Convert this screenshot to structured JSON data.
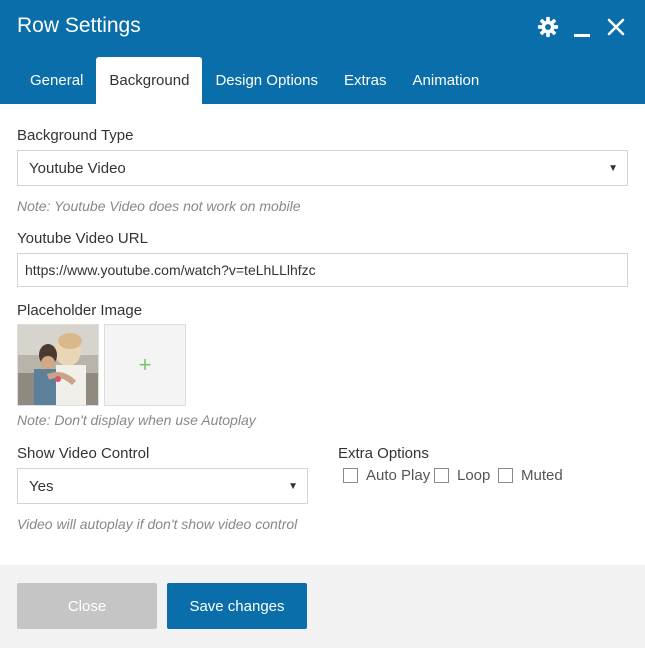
{
  "window": {
    "title": "Row Settings"
  },
  "header_icons": [
    "gear-icon",
    "minimize-icon",
    "close-icon"
  ],
  "tabs": [
    {
      "label": "General",
      "active": false
    },
    {
      "label": "Background",
      "active": true
    },
    {
      "label": "Design Options",
      "active": false
    },
    {
      "label": "Extras",
      "active": false
    },
    {
      "label": "Animation",
      "active": false
    }
  ],
  "background_type": {
    "label": "Background Type",
    "value": "Youtube Video",
    "note": "Note: Youtube Video does not work on mobile"
  },
  "youtube_url": {
    "label": "Youtube Video URL",
    "value": "https://www.youtube.com/watch?v=teLhLLlhfzc"
  },
  "placeholder_image": {
    "label": "Placeholder Image",
    "add_symbol": "+",
    "note": "Note: Don't display when use Autoplay"
  },
  "show_video_control": {
    "label": "Show Video Control",
    "value": "Yes",
    "note": "Video will autoplay if don't show video control"
  },
  "extra_options": {
    "label": "Extra Options",
    "items": [
      {
        "label": "Auto Play",
        "checked": false
      },
      {
        "label": "Loop",
        "checked": false
      },
      {
        "label": "Muted",
        "checked": false
      }
    ]
  },
  "footer": {
    "close_label": "Close",
    "save_label": "Save changes"
  },
  "colors": {
    "accent": "#0a6eaa",
    "close_button": "#c5c5c5",
    "add_plus": "#7ec26f"
  }
}
